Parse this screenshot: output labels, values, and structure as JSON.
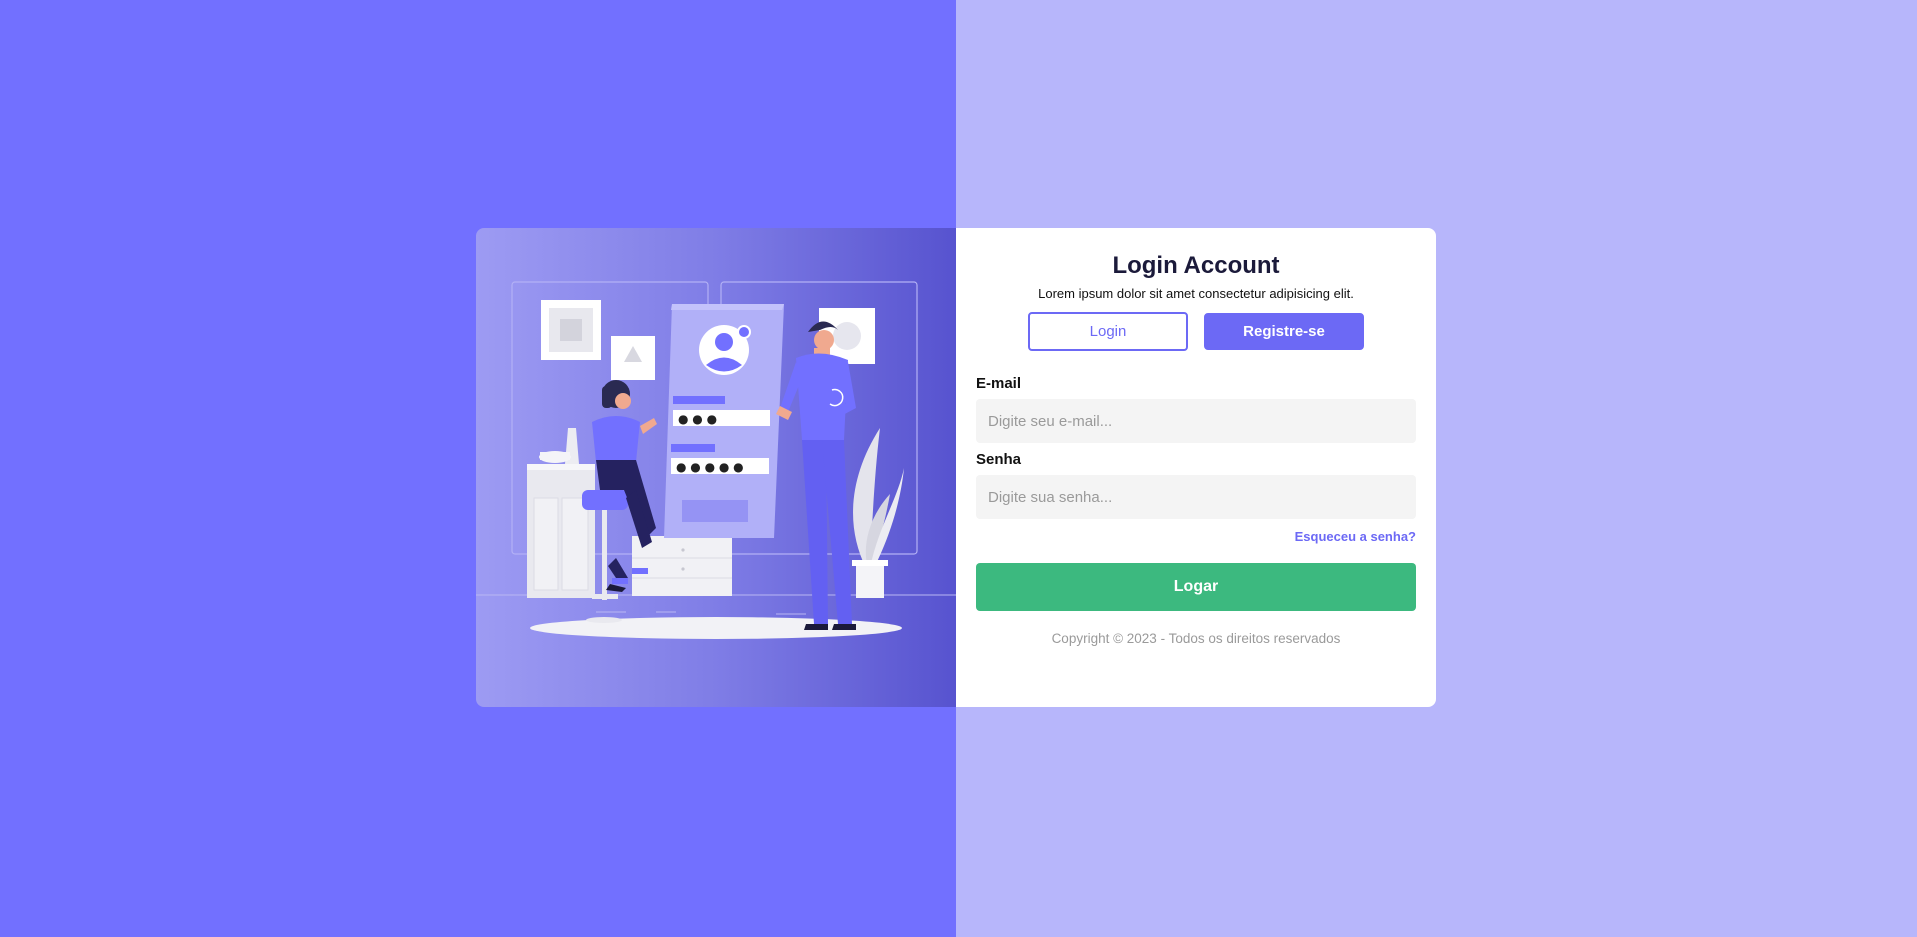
{
  "login": {
    "title": "Login Account",
    "subtitle": "Lorem ipsum dolor sit amet consectetur adipisicing elit.",
    "tabs": {
      "login_label": "Login",
      "register_label": "Registre-se"
    },
    "email": {
      "label": "E-mail",
      "placeholder": "Digite seu e-mail...",
      "value": ""
    },
    "password": {
      "label": "Senha",
      "placeholder": "Digite sua senha...",
      "value": ""
    },
    "forgot_link": "Esqueceu a senha?",
    "submit_label": "Logar",
    "copyright": "Copyright © 2023 - Todos os direitos reservados"
  },
  "illustration": {
    "icon": "login-illustration",
    "password_dots_1": "● ● ●",
    "password_dots_2": "● ● ● ● ●"
  },
  "colors": {
    "left_background": "#7270ff",
    "right_background": "#b7b6fb",
    "accent": "#6c69f5",
    "submit": "#3cb97f",
    "title": "#1b1a3a"
  }
}
